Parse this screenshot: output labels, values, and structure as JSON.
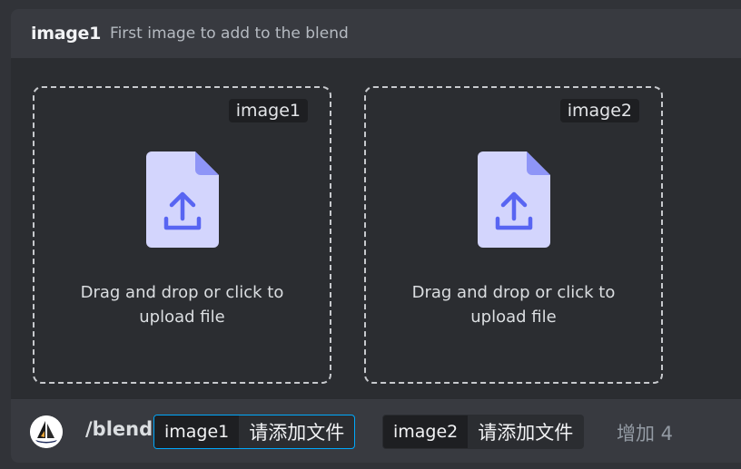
{
  "header": {
    "option_name": "image1",
    "option_description": "First image to add to the blend"
  },
  "upload_slots": [
    {
      "tag": "image1",
      "hint_line1": "Drag and drop or click to",
      "hint_line2": "upload file",
      "icon": "file-upload-icon"
    },
    {
      "tag": "image2",
      "hint_line1": "Drag and drop or click to",
      "hint_line2": "upload file",
      "icon": "file-upload-icon"
    }
  ],
  "command_bar": {
    "bot_avatar": "midjourney-sailboat-logo",
    "command": "/blend",
    "options": [
      {
        "name": "image1",
        "value": "请添加文件",
        "active": true
      },
      {
        "name": "image2",
        "value": "请添加文件",
        "active": false
      }
    ],
    "more_label": "增加 4"
  },
  "colors": {
    "accent_focus": "#00a8fc",
    "file_icon_body": "#c9cbff",
    "file_icon_arrow": "#5865f2"
  }
}
